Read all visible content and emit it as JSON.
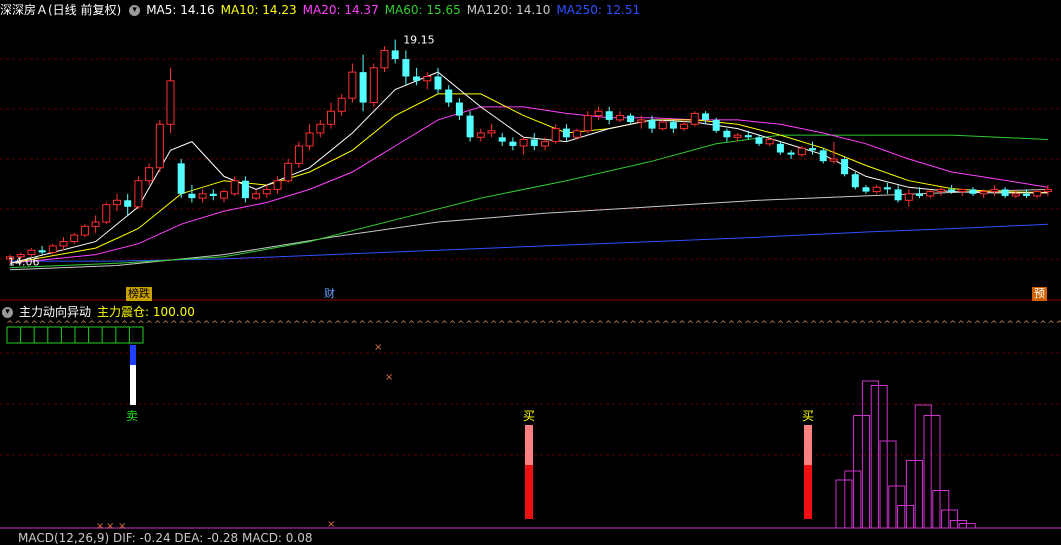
{
  "main_header": {
    "title": "深深房Ａ(日线 前复权)",
    "ma5": "MA5: 14.16",
    "ma10": "MA10: 14.23",
    "ma20": "MA20: 14.37",
    "ma60": "MA60: 15.65",
    "ma120": "MA120: 14.10",
    "ma250": "MA250: 12.51"
  },
  "colors": {
    "up": "#ff3030",
    "down": "#54ffff",
    "ma5": "#ffffff",
    "ma10": "#ffff00",
    "ma20": "#ff40ff",
    "ma60": "#33cc33",
    "ma120": "#c8c8c8",
    "ma250": "#3050ff"
  },
  "price_labels": {
    "high": "19.15",
    "low": "14.06"
  },
  "event_tags": {
    "t1": "榜跌",
    "t2": "财",
    "t3": "预"
  },
  "indicator_header": {
    "name": "主力动向异动",
    "value": "主力震仓: 100.00"
  },
  "signals": {
    "sell": "卖",
    "buy1": "买",
    "buy2": "买"
  },
  "macd_header": {
    "text": "MACD(12,26,9)  DIF: -0.24  DEA: -0.28  MACD: 0.08"
  },
  "chart_data": {
    "type": "candlestick",
    "x_count": 98,
    "ylim": [
      13.5,
      19.6
    ],
    "candles": [
      [
        14.1,
        14.2,
        14.0,
        14.15
      ],
      [
        14.15,
        14.25,
        14.1,
        14.2
      ],
      [
        14.2,
        14.35,
        14.15,
        14.3
      ],
      [
        14.3,
        14.4,
        14.2,
        14.25
      ],
      [
        14.25,
        14.45,
        14.2,
        14.4
      ],
      [
        14.4,
        14.6,
        14.3,
        14.5
      ],
      [
        14.5,
        14.7,
        14.45,
        14.65
      ],
      [
        14.65,
        14.9,
        14.6,
        14.85
      ],
      [
        14.85,
        15.1,
        14.7,
        14.95
      ],
      [
        14.95,
        15.4,
        14.9,
        15.35
      ],
      [
        15.35,
        15.6,
        15.2,
        15.45
      ],
      [
        15.45,
        15.6,
        15.1,
        15.3
      ],
      [
        15.3,
        16.0,
        15.25,
        15.9
      ],
      [
        15.9,
        16.3,
        15.8,
        16.2
      ],
      [
        16.2,
        17.3,
        16.1,
        17.2
      ],
      [
        17.2,
        18.5,
        17.0,
        18.2
      ],
      [
        16.3,
        16.4,
        15.5,
        15.6
      ],
      [
        15.6,
        15.8,
        15.4,
        15.5
      ],
      [
        15.5,
        15.7,
        15.4,
        15.6
      ],
      [
        15.6,
        15.7,
        15.45,
        15.55
      ],
      [
        15.5,
        15.7,
        15.4,
        15.65
      ],
      [
        15.6,
        16.0,
        15.55,
        15.9
      ],
      [
        15.9,
        16.0,
        15.4,
        15.5
      ],
      [
        15.5,
        15.7,
        15.45,
        15.6
      ],
      [
        15.6,
        15.8,
        15.5,
        15.7
      ],
      [
        15.7,
        16.0,
        15.6,
        15.9
      ],
      [
        15.9,
        16.4,
        15.85,
        16.3
      ],
      [
        16.3,
        16.8,
        16.2,
        16.7
      ],
      [
        16.7,
        17.2,
        16.6,
        17.0
      ],
      [
        17.0,
        17.3,
        16.9,
        17.2
      ],
      [
        17.2,
        17.7,
        17.1,
        17.5
      ],
      [
        17.5,
        17.9,
        17.4,
        17.8
      ],
      [
        17.8,
        18.6,
        17.7,
        18.4
      ],
      [
        18.4,
        18.8,
        17.5,
        17.7
      ],
      [
        17.7,
        18.6,
        17.6,
        18.5
      ],
      [
        18.5,
        19.0,
        18.4,
        18.9
      ],
      [
        18.9,
        19.15,
        18.6,
        18.7
      ],
      [
        18.7,
        18.9,
        18.1,
        18.3
      ],
      [
        18.3,
        18.5,
        18.1,
        18.2
      ],
      [
        18.2,
        18.4,
        18.0,
        18.3
      ],
      [
        18.3,
        18.5,
        17.9,
        18.0
      ],
      [
        18.0,
        18.1,
        17.6,
        17.7
      ],
      [
        17.7,
        17.8,
        17.3,
        17.4
      ],
      [
        17.4,
        17.5,
        16.8,
        16.9
      ],
      [
        16.9,
        17.1,
        16.8,
        17.0
      ],
      [
        17.0,
        17.2,
        16.9,
        17.05
      ],
      [
        16.9,
        17.0,
        16.7,
        16.8
      ],
      [
        16.8,
        16.9,
        16.6,
        16.7
      ],
      [
        16.7,
        16.9,
        16.5,
        16.85
      ],
      [
        16.85,
        17.0,
        16.6,
        16.7
      ],
      [
        16.7,
        16.9,
        16.6,
        16.8
      ],
      [
        16.8,
        17.2,
        16.75,
        17.1
      ],
      [
        17.1,
        17.2,
        16.8,
        16.9
      ],
      [
        16.9,
        17.1,
        16.85,
        17.05
      ],
      [
        17.05,
        17.5,
        17.0,
        17.4
      ],
      [
        17.4,
        17.6,
        17.3,
        17.5
      ],
      [
        17.5,
        17.6,
        17.2,
        17.3
      ],
      [
        17.3,
        17.5,
        17.25,
        17.4
      ],
      [
        17.4,
        17.45,
        17.2,
        17.25
      ],
      [
        17.25,
        17.4,
        17.1,
        17.3
      ],
      [
        17.3,
        17.4,
        17.0,
        17.1
      ],
      [
        17.1,
        17.3,
        17.05,
        17.25
      ],
      [
        17.25,
        17.3,
        17.0,
        17.1
      ],
      [
        17.1,
        17.3,
        17.05,
        17.2
      ],
      [
        17.2,
        17.5,
        17.15,
        17.45
      ],
      [
        17.45,
        17.5,
        17.2,
        17.3
      ],
      [
        17.3,
        17.35,
        17.0,
        17.05
      ],
      [
        17.05,
        17.1,
        16.8,
        16.9
      ],
      [
        16.9,
        17.0,
        16.8,
        16.95
      ],
      [
        16.95,
        17.05,
        16.85,
        16.9
      ],
      [
        16.9,
        16.95,
        16.7,
        16.75
      ],
      [
        16.75,
        16.9,
        16.7,
        16.85
      ],
      [
        16.75,
        16.8,
        16.5,
        16.55
      ],
      [
        16.55,
        16.6,
        16.4,
        16.5
      ],
      [
        16.5,
        16.7,
        16.45,
        16.65
      ],
      [
        16.65,
        16.8,
        16.5,
        16.6
      ],
      [
        16.6,
        16.65,
        16.3,
        16.35
      ],
      [
        16.35,
        16.8,
        16.3,
        16.4
      ],
      [
        16.4,
        16.45,
        16.0,
        16.05
      ],
      [
        16.05,
        16.1,
        15.7,
        15.75
      ],
      [
        15.75,
        15.8,
        15.6,
        15.65
      ],
      [
        15.65,
        15.8,
        15.6,
        15.75
      ],
      [
        15.75,
        15.85,
        15.6,
        15.7
      ],
      [
        15.7,
        15.8,
        15.4,
        15.45
      ],
      [
        15.45,
        15.7,
        15.3,
        15.6
      ],
      [
        15.6,
        15.75,
        15.5,
        15.55
      ],
      [
        15.55,
        15.7,
        15.5,
        15.65
      ],
      [
        15.65,
        15.75,
        15.55,
        15.7
      ],
      [
        15.7,
        15.8,
        15.6,
        15.65
      ],
      [
        15.65,
        15.7,
        15.55,
        15.7
      ],
      [
        15.7,
        15.75,
        15.55,
        15.6
      ],
      [
        15.6,
        15.7,
        15.5,
        15.65
      ],
      [
        15.65,
        15.8,
        15.55,
        15.7
      ],
      [
        15.7,
        15.75,
        15.5,
        15.55
      ],
      [
        15.55,
        15.7,
        15.5,
        15.6
      ],
      [
        15.6,
        15.7,
        15.5,
        15.55
      ],
      [
        15.55,
        15.7,
        15.5,
        15.65
      ],
      [
        15.65,
        15.8,
        15.55,
        15.7
      ]
    ],
    "ma_lines": {
      "ma5": [
        [
          0,
          14.0
        ],
        [
          8,
          14.5
        ],
        [
          12,
          15.3
        ],
        [
          15,
          16.6
        ],
        [
          17,
          16.8
        ],
        [
          20,
          16.0
        ],
        [
          23,
          15.7
        ],
        [
          28,
          16.2
        ],
        [
          32,
          17.0
        ],
        [
          36,
          18.0
        ],
        [
          40,
          18.4
        ],
        [
          44,
          17.6
        ],
        [
          48,
          16.9
        ],
        [
          52,
          16.8
        ],
        [
          56,
          17.1
        ],
        [
          60,
          17.3
        ],
        [
          64,
          17.25
        ],
        [
          68,
          17.1
        ],
        [
          72,
          16.8
        ],
        [
          76,
          16.5
        ],
        [
          80,
          16.0
        ],
        [
          84,
          15.75
        ],
        [
          88,
          15.65
        ],
        [
          92,
          15.62
        ],
        [
          97,
          15.62
        ]
      ],
      "ma10": [
        [
          0,
          14.0
        ],
        [
          8,
          14.35
        ],
        [
          12,
          14.8
        ],
        [
          16,
          15.6
        ],
        [
          20,
          15.9
        ],
        [
          24,
          15.8
        ],
        [
          28,
          16.1
        ],
        [
          32,
          16.6
        ],
        [
          36,
          17.4
        ],
        [
          40,
          17.9
        ],
        [
          44,
          17.9
        ],
        [
          48,
          17.4
        ],
        [
          52,
          17.0
        ],
        [
          56,
          17.1
        ],
        [
          60,
          17.3
        ],
        [
          64,
          17.3
        ],
        [
          68,
          17.2
        ],
        [
          72,
          16.95
        ],
        [
          76,
          16.65
        ],
        [
          80,
          16.25
        ],
        [
          84,
          15.9
        ],
        [
          88,
          15.72
        ],
        [
          92,
          15.65
        ],
        [
          97,
          15.63
        ]
      ],
      "ma20": [
        [
          0,
          14.0
        ],
        [
          8,
          14.2
        ],
        [
          12,
          14.45
        ],
        [
          16,
          14.9
        ],
        [
          20,
          15.2
        ],
        [
          24,
          15.4
        ],
        [
          28,
          15.7
        ],
        [
          32,
          16.1
        ],
        [
          36,
          16.7
        ],
        [
          40,
          17.3
        ],
        [
          44,
          17.6
        ],
        [
          48,
          17.6
        ],
        [
          52,
          17.45
        ],
        [
          56,
          17.35
        ],
        [
          60,
          17.35
        ],
        [
          64,
          17.3
        ],
        [
          68,
          17.3
        ],
        [
          72,
          17.2
        ],
        [
          76,
          17.0
        ],
        [
          80,
          16.75
        ],
        [
          84,
          16.4
        ],
        [
          88,
          16.1
        ],
        [
          92,
          15.95
        ],
        [
          97,
          15.75
        ]
      ],
      "ma60": [
        [
          0,
          13.9
        ],
        [
          10,
          14.0
        ],
        [
          20,
          14.15
        ],
        [
          28,
          14.5
        ],
        [
          36,
          15.0
        ],
        [
          44,
          15.5
        ],
        [
          52,
          15.9
        ],
        [
          60,
          16.35
        ],
        [
          66,
          16.75
        ],
        [
          72,
          16.95
        ],
        [
          80,
          16.95
        ],
        [
          88,
          16.95
        ],
        [
          97,
          16.85
        ]
      ],
      "ma120": [
        [
          0,
          13.85
        ],
        [
          10,
          13.95
        ],
        [
          20,
          14.2
        ],
        [
          30,
          14.6
        ],
        [
          40,
          14.95
        ],
        [
          50,
          15.15
        ],
        [
          60,
          15.3
        ],
        [
          70,
          15.45
        ],
        [
          80,
          15.55
        ],
        [
          90,
          15.65
        ],
        [
          97,
          15.7
        ]
      ],
      "ma250": [
        [
          0,
          14.05
        ],
        [
          10,
          14.05
        ],
        [
          20,
          14.1
        ],
        [
          30,
          14.2
        ],
        [
          40,
          14.3
        ],
        [
          50,
          14.4
        ],
        [
          60,
          14.5
        ],
        [
          70,
          14.6
        ],
        [
          80,
          14.72
        ],
        [
          90,
          14.82
        ],
        [
          97,
          14.9
        ]
      ]
    },
    "indicator": {
      "green_grid_cells": 10,
      "sell_index": 15,
      "buy_indices": [
        61,
        94
      ],
      "histogram": [
        [
          95,
          0.32
        ],
        [
          96,
          0.38
        ],
        [
          97,
          0.75
        ],
        [
          98,
          0.98
        ],
        [
          99,
          0.95
        ],
        [
          100,
          0.58
        ],
        [
          101,
          0.28
        ],
        [
          102,
          0.15
        ],
        [
          103,
          0.45
        ],
        [
          104,
          0.82
        ],
        [
          105,
          0.75
        ],
        [
          106,
          0.25
        ],
        [
          107,
          0.12
        ],
        [
          108,
          0.05
        ],
        [
          109,
          0.03
        ]
      ]
    }
  }
}
